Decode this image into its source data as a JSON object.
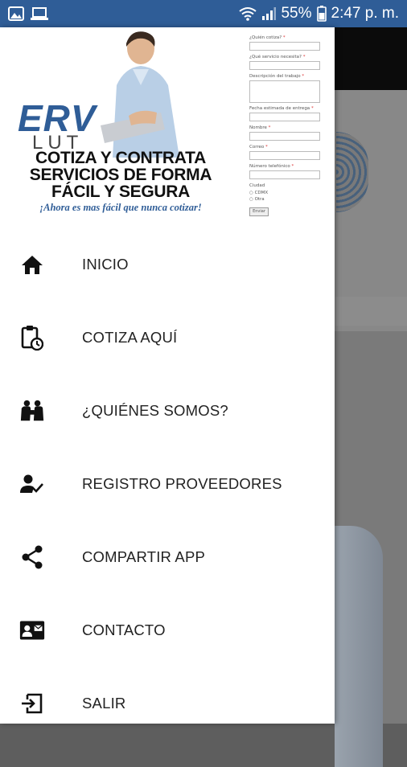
{
  "status_bar": {
    "battery_percent": "55%",
    "time": "2:47 p. m.",
    "icons": [
      "image-icon",
      "laptop-icon",
      "wifi-icon",
      "signal-icon",
      "battery-icon"
    ]
  },
  "header": {
    "logo_text_1": "ERV",
    "logo_text_2": "LUT",
    "headline_line1": "COTIZA Y CONTRATA",
    "headline_line2": "SERVICIOS DE FORMA",
    "headline_line3": "FÁCIL Y SEGURA",
    "tagline": "¡Ahora es mas fácil que nunca cotizar!",
    "form": {
      "q1": "¿Quién cotiza?",
      "q2": "¿Qué servicio necesita?",
      "q3": "Descripción del trabajo",
      "q4": "Fecha estimada de entrega",
      "q5": "Nombre",
      "q6": "Correo",
      "q7": "Número telefónico",
      "q8": "Ciudad",
      "opt1": "CDMX",
      "opt2": "Otra",
      "submit": "Enviar",
      "required_mark": "*"
    }
  },
  "menu": {
    "items": [
      {
        "label": "INICIO",
        "icon": "home-icon"
      },
      {
        "label": "COTIZA AQUÍ",
        "icon": "clipboard-clock-icon"
      },
      {
        "label": "¿QUIÉNES SOMOS?",
        "icon": "people-icon"
      },
      {
        "label": "REGISTRO PROVEEDORES",
        "icon": "user-check-icon"
      },
      {
        "label": "COMPARTIR APP",
        "icon": "share-icon"
      },
      {
        "label": "CONTACTO",
        "icon": "contact-card-icon"
      },
      {
        "label": "SALIR",
        "icon": "exit-icon"
      }
    ]
  },
  "colors": {
    "status_bar": "#2f5d97",
    "brand_blue": "#2f5d97",
    "scrim": "#5e5e5e",
    "drawer_bg": "#ffffff",
    "menu_text": "#222222"
  }
}
